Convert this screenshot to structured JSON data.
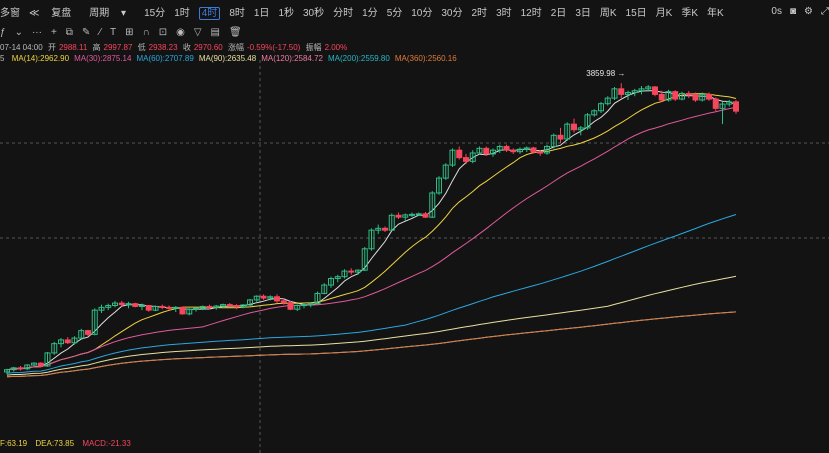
{
  "toolbar": {
    "left_frag": "多窗",
    "adjust": "复盘",
    "period_label": "周期",
    "timeframes": [
      "15分",
      "1时",
      "4时",
      "8时",
      "1日",
      "1秒",
      "30秒",
      "分时",
      "1分",
      "5分",
      "10分",
      "30分",
      "2时",
      "3时",
      "12时",
      "2日",
      "3日",
      "周K",
      "15日",
      "月K",
      "季K",
      "年K"
    ],
    "active_timeframe": "4时",
    "right_text": "0s"
  },
  "ohlc": {
    "date": "07-14 04:00",
    "open_label": "开",
    "open": "2988.11",
    "high_label": "高",
    "high": "2997.87",
    "low_label": "低",
    "low": "2938.23",
    "close_label": "收",
    "close": "2970.60",
    "change_label": "涨幅",
    "change": "-0.59%(-17.50)",
    "amp_label": "振幅",
    "amplitude": "2.00%"
  },
  "ma_line": {
    "lead": "5",
    "items": [
      {
        "text": "MA(14):2962.90",
        "color": "#f0d341"
      },
      {
        "text": "MA(30):2875.14",
        "color": "#e05a9b"
      },
      {
        "text": "MA(60):2707.89",
        "color": "#2aa8e0"
      },
      {
        "text": "MA(90):2635.48",
        "color": "#e8e0a0"
      },
      {
        "text": "MA(120):2584.72",
        "color": "#f07ca0"
      },
      {
        "text": "MA(200):2559.80",
        "color": "#27b8c8"
      },
      {
        "text": "MA(360):2560.16",
        "color": "#e07a3a"
      }
    ]
  },
  "peak_label": "3859.98",
  "macd": {
    "dif": "F:63.19",
    "dea": "DEA:73.85",
    "macd": "MACD:-21.33"
  },
  "colors": {
    "up": "#2ebd85",
    "down": "#f6465d",
    "bg": "#131313"
  },
  "chart_data": {
    "type": "candlestick",
    "price_min": 2000,
    "price_max": 4000,
    "peak_high": 3859.98,
    "candles": [
      [
        2108,
        2125,
        2095,
        2120
      ],
      [
        2120,
        2135,
        2110,
        2130
      ],
      [
        2130,
        2140,
        2115,
        2125
      ],
      [
        2125,
        2150,
        2118,
        2145
      ],
      [
        2145,
        2160,
        2138,
        2155
      ],
      [
        2155,
        2160,
        2135,
        2140
      ],
      [
        2140,
        2215,
        2135,
        2210
      ],
      [
        2210,
        2270,
        2200,
        2260
      ],
      [
        2260,
        2290,
        2240,
        2280
      ],
      [
        2280,
        2295,
        2258,
        2265
      ],
      [
        2265,
        2300,
        2255,
        2290
      ],
      [
        2290,
        2340,
        2285,
        2330
      ],
      [
        2330,
        2335,
        2300,
        2310
      ],
      [
        2310,
        2450,
        2305,
        2440
      ],
      [
        2440,
        2470,
        2425,
        2455
      ],
      [
        2455,
        2475,
        2440,
        2465
      ],
      [
        2465,
        2490,
        2455,
        2478
      ],
      [
        2478,
        2490,
        2460,
        2470
      ],
      [
        2470,
        2485,
        2450,
        2475
      ],
      [
        2475,
        2480,
        2455,
        2460
      ],
      [
        2460,
        2475,
        2440,
        2465
      ],
      [
        2465,
        2468,
        2432,
        2440
      ],
      [
        2440,
        2465,
        2435,
        2460
      ],
      [
        2460,
        2470,
        2445,
        2455
      ],
      [
        2455,
        2465,
        2442,
        2450
      ],
      [
        2450,
        2462,
        2430,
        2455
      ],
      [
        2455,
        2460,
        2415,
        2420
      ],
      [
        2420,
        2450,
        2412,
        2445
      ],
      [
        2445,
        2455,
        2432,
        2450
      ],
      [
        2450,
        2465,
        2440,
        2460
      ],
      [
        2460,
        2470,
        2445,
        2455
      ],
      [
        2455,
        2468,
        2442,
        2462
      ],
      [
        2462,
        2475,
        2452,
        2470
      ],
      [
        2470,
        2478,
        2455,
        2465
      ],
      [
        2465,
        2472,
        2445,
        2458
      ],
      [
        2458,
        2472,
        2450,
        2468
      ],
      [
        2468,
        2500,
        2462,
        2495
      ],
      [
        2495,
        2520,
        2485,
        2515
      ],
      [
        2515,
        2525,
        2495,
        2505
      ],
      [
        2505,
        2520,
        2492,
        2512
      ],
      [
        2512,
        2525,
        2480,
        2490
      ],
      [
        2490,
        2505,
        2470,
        2480
      ],
      [
        2480,
        2490,
        2440,
        2445
      ],
      [
        2445,
        2470,
        2435,
        2465
      ],
      [
        2465,
        2480,
        2450,
        2470
      ],
      [
        2470,
        2480,
        2455,
        2475
      ],
      [
        2475,
        2540,
        2470,
        2530
      ],
      [
        2530,
        2585,
        2525,
        2575
      ],
      [
        2575,
        2620,
        2560,
        2610
      ],
      [
        2610,
        2630,
        2590,
        2620
      ],
      [
        2620,
        2660,
        2610,
        2650
      ],
      [
        2650,
        2665,
        2630,
        2645
      ],
      [
        2645,
        2660,
        2630,
        2655
      ],
      [
        2655,
        2780,
        2650,
        2770
      ],
      [
        2770,
        2880,
        2760,
        2870
      ],
      [
        2870,
        2900,
        2850,
        2880
      ],
      [
        2880,
        2890,
        2860,
        2870
      ],
      [
        2870,
        2960,
        2865,
        2950
      ],
      [
        2950,
        2965,
        2930,
        2940
      ],
      [
        2940,
        2960,
        2920,
        2952
      ],
      [
        2952,
        2965,
        2940,
        2955
      ],
      [
        2955,
        2965,
        2945,
        2958
      ],
      [
        2958,
        2968,
        2935,
        2940
      ],
      [
        2940,
        3080,
        2935,
        3070
      ],
      [
        3070,
        3160,
        3060,
        3150
      ],
      [
        3150,
        3230,
        3140,
        3220
      ],
      [
        3220,
        3310,
        3210,
        3300
      ],
      [
        3300,
        3320,
        3250,
        3260
      ],
      [
        3260,
        3280,
        3225,
        3240
      ],
      [
        3240,
        3300,
        3230,
        3285
      ],
      [
        3285,
        3320,
        3275,
        3310
      ],
      [
        3310,
        3320,
        3270,
        3280
      ],
      [
        3280,
        3310,
        3265,
        3300
      ],
      [
        3300,
        3330,
        3285,
        3320
      ],
      [
        3320,
        3330,
        3290,
        3300
      ],
      [
        3300,
        3310,
        3280,
        3292
      ],
      [
        3292,
        3315,
        3280,
        3305
      ],
      [
        3305,
        3320,
        3290,
        3312
      ],
      [
        3312,
        3318,
        3282,
        3290
      ],
      [
        3290,
        3300,
        3270,
        3285
      ],
      [
        3285,
        3330,
        3275,
        3320
      ],
      [
        3320,
        3390,
        3310,
        3380
      ],
      [
        3380,
        3420,
        3340,
        3360
      ],
      [
        3360,
        3450,
        3350,
        3440
      ],
      [
        3440,
        3470,
        3395,
        3410
      ],
      [
        3410,
        3430,
        3380,
        3420
      ],
      [
        3420,
        3500,
        3410,
        3490
      ],
      [
        3490,
        3520,
        3480,
        3512
      ],
      [
        3512,
        3560,
        3500,
        3550
      ],
      [
        3550,
        3590,
        3540,
        3580
      ],
      [
        3580,
        3640,
        3570,
        3630
      ],
      [
        3630,
        3660,
        3580,
        3600
      ],
      [
        3600,
        3620,
        3570,
        3610
      ],
      [
        3610,
        3630,
        3590,
        3620
      ],
      [
        3620,
        3645,
        3600,
        3630
      ],
      [
        3630,
        3650,
        3615,
        3640
      ],
      [
        3640,
        3645,
        3590,
        3600
      ],
      [
        3600,
        3620,
        3560,
        3570
      ],
      [
        3570,
        3625,
        3562,
        3615
      ],
      [
        3615,
        3622,
        3565,
        3575
      ],
      [
        3575,
        3615,
        3568,
        3605
      ],
      [
        3605,
        3618,
        3580,
        3598
      ],
      [
        3598,
        3610,
        3560,
        3570
      ],
      [
        3570,
        3610,
        3562,
        3600
      ],
      [
        3600,
        3610,
        3565,
        3575
      ],
      [
        3575,
        3585,
        3510,
        3525
      ],
      [
        3525,
        3560,
        3440,
        3548
      ],
      [
        3548,
        3570,
        3535,
        3560
      ],
      [
        3560,
        3570,
        3495,
        3510
      ]
    ]
  }
}
